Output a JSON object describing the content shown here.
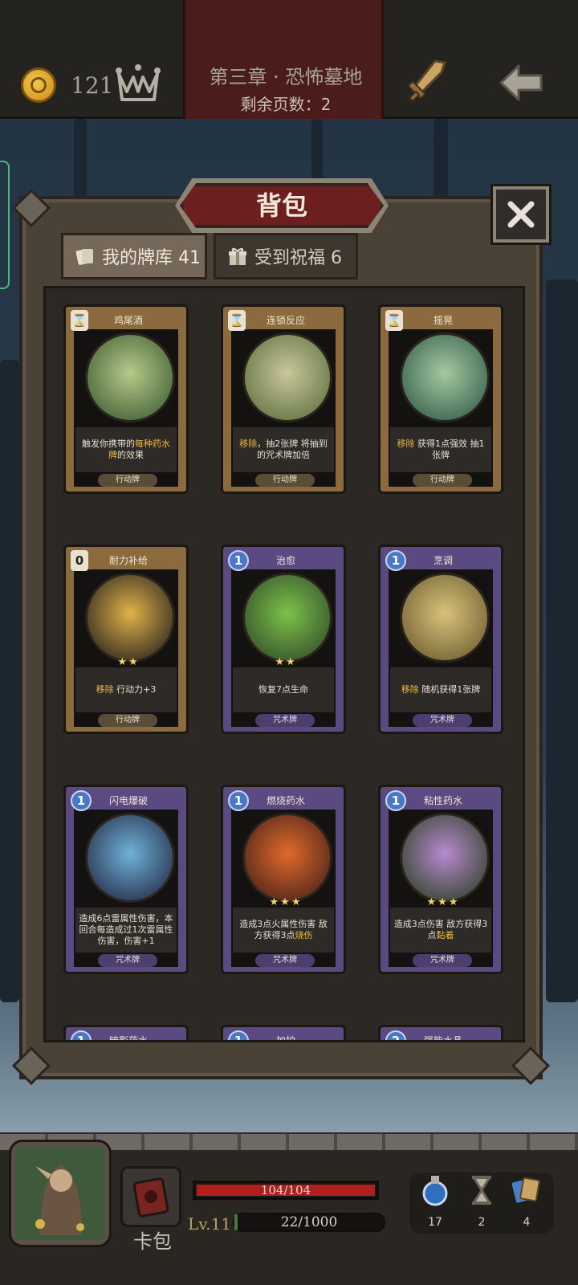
{
  "topbar": {
    "coins": "121",
    "chapter_title": "第三章 · 恐怖墓地",
    "pages_remaining": "剩余页数：2"
  },
  "panel": {
    "title": "背包",
    "tabs": [
      {
        "label": "我的牌库 41",
        "active": true,
        "icon": "card-deck-icon"
      },
      {
        "label": "受到祝福 6",
        "active": false,
        "icon": "gift-icon"
      }
    ]
  },
  "cards": [
    {
      "name": "鸡尾酒",
      "cost": "⌛",
      "kind": "action",
      "desc_a": "触发你携带的",
      "desc_hl": "每种药水牌",
      "desc_b": "的效果",
      "type": "行动牌",
      "stars": ""
    },
    {
      "name": "连锁反应",
      "cost": "⌛",
      "kind": "action",
      "desc_a": "",
      "desc_hl": "移除",
      "desc_b": "，抽2张牌 将抽到的咒术牌加倍",
      "type": "行动牌",
      "stars": ""
    },
    {
      "name": "摇晃",
      "cost": "⌛",
      "kind": "action",
      "desc_a": "",
      "desc_hl": "移除",
      "desc_b": " 获得1点强效 抽1张牌",
      "type": "行动牌",
      "stars": ""
    },
    {
      "name": "耐力补给",
      "cost": "0",
      "kind": "action",
      "desc_a": "",
      "desc_hl": "移除",
      "desc_b": " 行动力+3",
      "type": "行动牌",
      "stars": "★★"
    },
    {
      "name": "治愈",
      "cost": "1",
      "kind": "spell",
      "desc_a": "恢复7点生命",
      "desc_hl": "",
      "desc_b": "",
      "type": "咒术牌",
      "stars": "★★"
    },
    {
      "name": "烹调",
      "cost": "1",
      "kind": "spell",
      "desc_a": "",
      "desc_hl": "移除",
      "desc_b": " 随机获得1张牌",
      "type": "咒术牌",
      "stars": ""
    },
    {
      "name": "闪电爆破",
      "cost": "1",
      "kind": "spell",
      "desc_a": "造成6点雷属性伤害，本回合每造成过1次雷属性伤害，伤害+1",
      "desc_hl": "",
      "desc_b": "",
      "type": "咒术牌",
      "stars": ""
    },
    {
      "name": "燃烧药水",
      "cost": "1",
      "kind": "spell",
      "desc_a": "造成3点火属性伤害 敌方获得3点",
      "desc_hl": "烧伤",
      "desc_b": "",
      "type": "咒术牌",
      "stars": "★★★"
    },
    {
      "name": "粘性药水",
      "cost": "1",
      "kind": "spell",
      "desc_a": "造成3点伤害 敌方获得3点",
      "desc_hl": "黏着",
      "desc_b": "",
      "type": "咒术牌",
      "stars": "★★★"
    },
    {
      "name": "暗影药水",
      "cost": "1",
      "kind": "spell",
      "desc_a": "",
      "desc_hl": "",
      "desc_b": "",
      "type": "",
      "stars": ""
    },
    {
      "name": "加护",
      "cost": "1",
      "kind": "spell",
      "desc_a": "",
      "desc_hl": "",
      "desc_b": "",
      "type": "",
      "stars": ""
    },
    {
      "name": "强能水晶",
      "cost": "2",
      "kind": "spell",
      "desc_a": "",
      "desc_hl": "",
      "desc_b": "",
      "type": "",
      "stars": ""
    }
  ],
  "bottom": {
    "bag_label": "卡包",
    "hp_text": "104/104",
    "hp_fraction": 1.0,
    "level": "Lv.11",
    "xp_text": "22/1000",
    "xp_fraction": 0.022,
    "potions": "17",
    "hourglass": "2",
    "cards": "4"
  }
}
